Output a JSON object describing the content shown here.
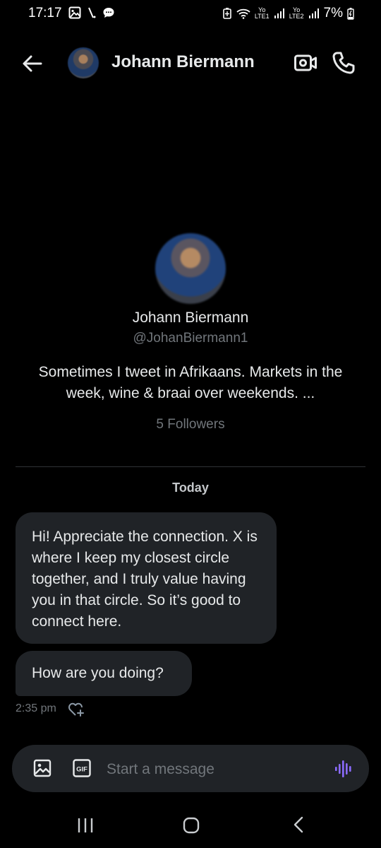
{
  "status_bar": {
    "time": "17:17",
    "network_1_top": "Yo",
    "network_1_bottom": "LTE1",
    "network_2_top": "Yo",
    "network_2_bottom": "LTE2",
    "battery": "7%",
    "icons": [
      "image-icon",
      "slash-icon",
      "chat-bubble-icon",
      "battery-saver-icon",
      "wifi-icon",
      "signal-icon",
      "signal-icon",
      "battery-charging-icon"
    ]
  },
  "header": {
    "name": "Johann Biermann"
  },
  "profile": {
    "name": "Johann Biermann",
    "handle": "@JohanBiermann1",
    "bio": "Sometimes I tweet in Afrikaans. Markets in the week, wine & braai over weekends. ...",
    "followers": "5 Followers"
  },
  "conversation": {
    "date_separator": "Today",
    "messages": [
      {
        "text": "Hi! Appreciate the connection. X is where I keep my closest circle together, and I truly value having you in that circle. So it’s good to connect here."
      },
      {
        "text": "How are you doing?"
      }
    ],
    "last_timestamp": "2:35 pm"
  },
  "composer": {
    "placeholder": "Start a message",
    "gif_label": "GIF"
  },
  "colors": {
    "background": "#000000",
    "bubble": "#202327",
    "secondary_text": "#71767b",
    "voice_accent": "#8b6bff"
  }
}
